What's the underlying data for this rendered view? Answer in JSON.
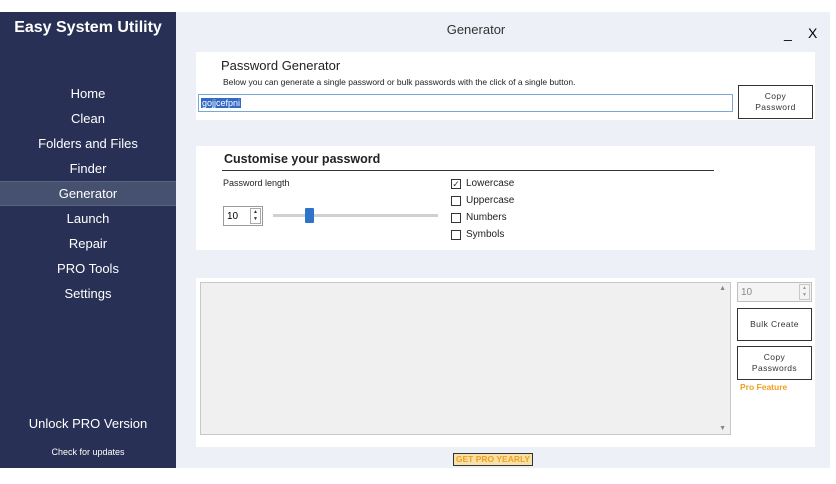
{
  "app": {
    "title": "Easy System Utility",
    "unlock_label": "Unlock PRO Version",
    "check_updates_label": "Check for updates"
  },
  "sidebar": {
    "items": [
      {
        "label": "Home"
      },
      {
        "label": "Clean"
      },
      {
        "label": "Folders and Files"
      },
      {
        "label": "Finder"
      },
      {
        "label": "Generator",
        "active": true
      },
      {
        "label": "Launch"
      },
      {
        "label": "Repair"
      },
      {
        "label": "PRO Tools"
      },
      {
        "label": "Settings"
      }
    ]
  },
  "window": {
    "title": "Generator",
    "minimize_label": "_",
    "close_label": "X"
  },
  "generator": {
    "title": "Password Generator",
    "description": "Below you can generate a single password or bulk passwords with the click of a single button.",
    "password_value": "gojjcefpni",
    "copy_button": [
      "Copy",
      "Password"
    ]
  },
  "customise": {
    "title": "Customise your password",
    "length_label": "Password length",
    "length_value": "10",
    "slider_fraction": 0.22,
    "options": [
      {
        "label": "Lowercase",
        "checked": true
      },
      {
        "label": "Uppercase",
        "checked": false
      },
      {
        "label": "Numbers",
        "checked": false
      },
      {
        "label": "Symbols",
        "checked": false
      }
    ]
  },
  "bulk": {
    "count_value": "10",
    "bulk_create_label": "Bulk Create",
    "copy_passwords_label": [
      "Copy",
      "Passwords"
    ],
    "pro_feature_label": "Pro Feature"
  },
  "footer": {
    "get_pro_label": "GET PRO YEARLY"
  },
  "colors": {
    "sidebar_bg": "#283155",
    "main_bg": "#eef0f8",
    "accent": "#2f72c9",
    "pro_orange": "#f0a020"
  }
}
